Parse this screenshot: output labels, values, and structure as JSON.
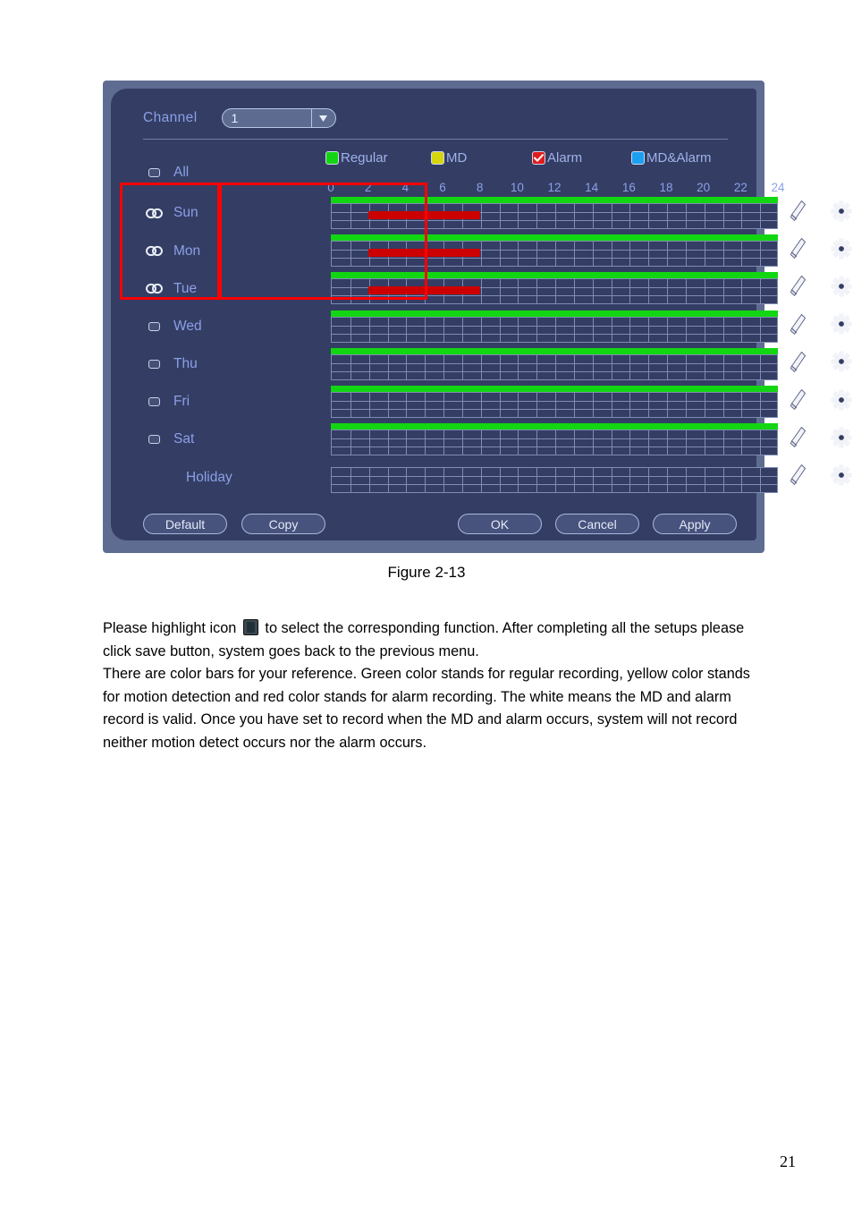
{
  "dialog": {
    "channel": {
      "label": "Channel",
      "value": "1",
      "arrow_icon": "chevron-down-icon"
    },
    "legend": [
      {
        "name": "Regular",
        "color": "#13d613",
        "checked": false
      },
      {
        "name": "MD",
        "color": "#d6d60f",
        "checked": false
      },
      {
        "name": "Alarm",
        "color": "#e01b1b",
        "checked": true
      },
      {
        "name": "MD&Alarm",
        "color": "#1b9ff0",
        "checked": false
      }
    ],
    "all_row": {
      "label": "All",
      "checked": false
    },
    "hour_ticks": [
      "0",
      "2",
      "4",
      "6",
      "8",
      "10",
      "12",
      "14",
      "16",
      "18",
      "20",
      "22",
      "24"
    ],
    "rows": [
      {
        "label": "Sun",
        "icon": "chain-link-icon",
        "checked": false,
        "regular": true,
        "alarm_start": 2,
        "alarm_end": 8
      },
      {
        "label": "Mon",
        "icon": "chain-link-icon",
        "checked": false,
        "regular": true,
        "alarm_start": 2,
        "alarm_end": 8
      },
      {
        "label": "Tue",
        "icon": "chain-link-icon",
        "checked": false,
        "regular": true,
        "alarm_start": 2,
        "alarm_end": 8
      },
      {
        "label": "Wed",
        "icon": "checkbox-icon",
        "checked": false,
        "regular": true,
        "alarm_start": null,
        "alarm_end": null
      },
      {
        "label": "Thu",
        "icon": "checkbox-icon",
        "checked": false,
        "regular": true,
        "alarm_start": null,
        "alarm_end": null
      },
      {
        "label": "Fri",
        "icon": "checkbox-icon",
        "checked": false,
        "regular": true,
        "alarm_start": null,
        "alarm_end": null
      },
      {
        "label": "Sat",
        "icon": "checkbox-icon",
        "checked": false,
        "regular": true,
        "alarm_start": null,
        "alarm_end": null
      },
      {
        "label": "Holiday",
        "icon": "none",
        "checked": false,
        "regular": false,
        "alarm_start": null,
        "alarm_end": null
      }
    ],
    "row_icons": {
      "copy_icon": "pencil-icon",
      "setup_icon": "gear-icon"
    },
    "buttons": {
      "default": "Default",
      "copy": "Copy",
      "ok": "OK",
      "cancel": "Cancel",
      "apply": "Apply"
    }
  },
  "annotations": {
    "label_box_color": "#ff0000",
    "timeline_box_color": "#ff0000"
  },
  "document": {
    "figure_caption": "Figure 2-13",
    "para1_before": "Please highlight icon",
    "para1_after": "to select the corresponding function. After completing all the setups please click save button, system goes back to the previous menu.",
    "para2": "There are color bars for your reference. Green color stands for regular recording, yellow color stands for motion detection and red color stands for alarm recording. The white means the MD and alarm record is valid. Once you have set to record when the MD and alarm occurs, system will not record neither motion detect occurs nor the alarm occurs.",
    "page_number": "21"
  }
}
